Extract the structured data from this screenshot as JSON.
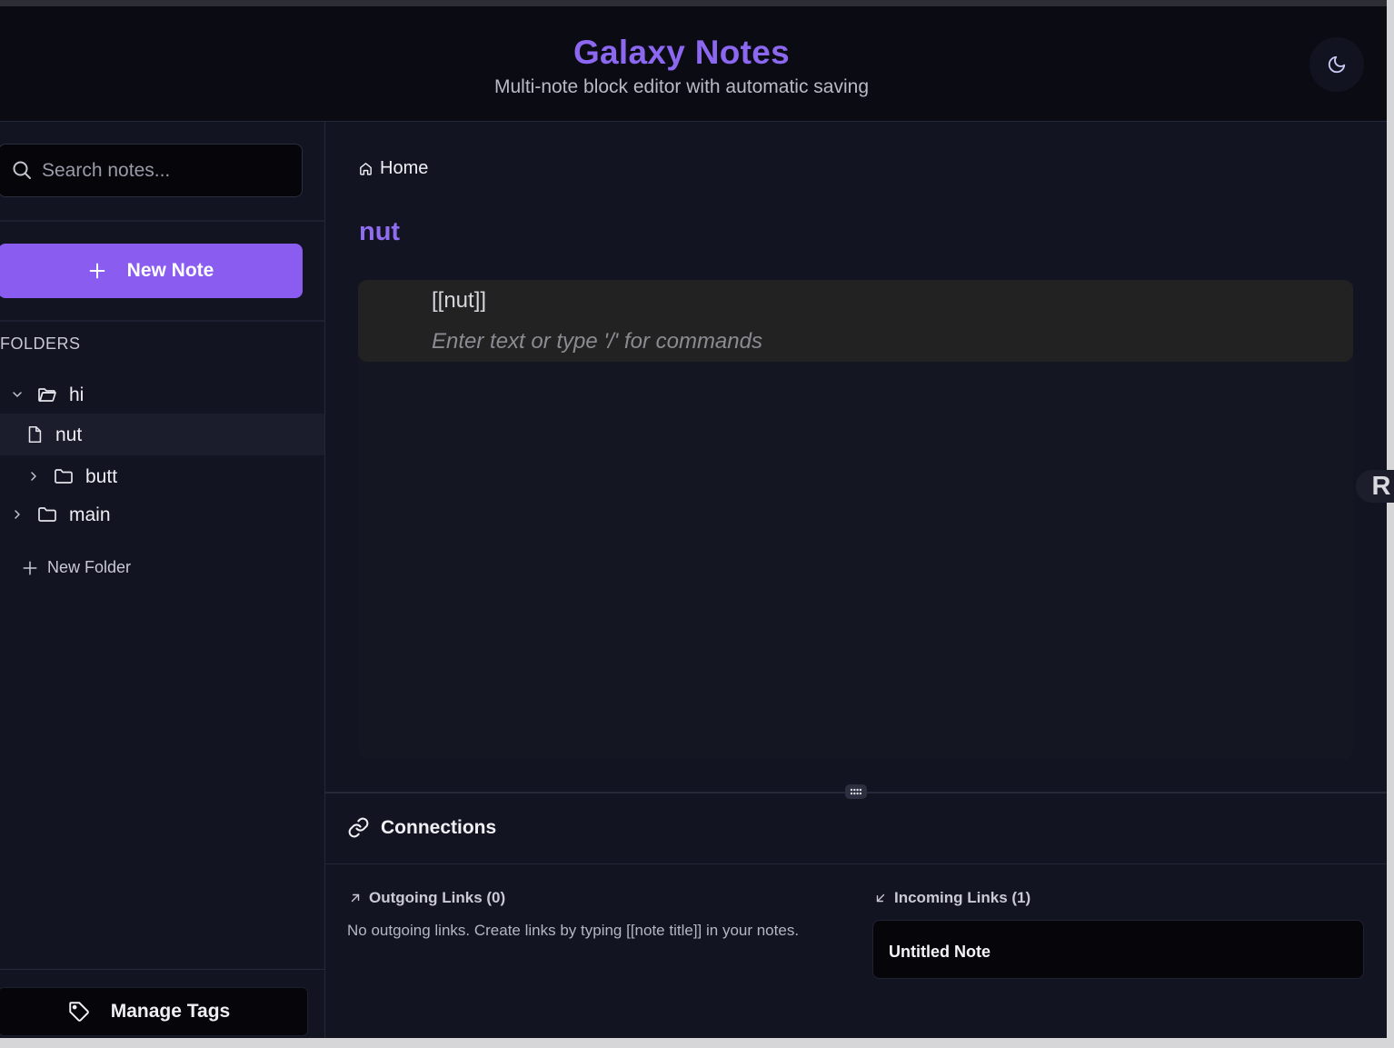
{
  "header": {
    "title": "Galaxy Notes",
    "subtitle": "Multi-note block editor with automatic saving",
    "theme_icon": "moon-icon"
  },
  "sidebar": {
    "search": {
      "placeholder": "Search notes...",
      "value": ""
    },
    "new_note_label": "New Note",
    "folders_label": "FOLDERS",
    "tree": [
      {
        "type": "folder",
        "label": "hi",
        "expanded": true,
        "depth": 0
      },
      {
        "type": "note",
        "label": "nut",
        "selected": true,
        "depth": 1
      },
      {
        "type": "folder",
        "label": "butt",
        "expanded": false,
        "depth": 1
      },
      {
        "type": "folder",
        "label": "main",
        "expanded": false,
        "depth": 0
      }
    ],
    "new_folder_label": "New Folder",
    "manage_tags_label": "Manage Tags"
  },
  "main": {
    "breadcrumb": "Home",
    "note_title": "nut",
    "editor": {
      "block_text": "[[nut]]",
      "placeholder": "Enter text or type '/' for commands"
    },
    "connections": {
      "title": "Connections",
      "outgoing": {
        "label": "Outgoing Links (0)",
        "empty_text": "No outgoing links. Create links by typing [[note title]] in your notes."
      },
      "incoming": {
        "label": "Incoming Links (1)",
        "items": [
          "Untitled Note"
        ]
      }
    }
  },
  "overlay": {
    "side_bubble_letter": "R"
  },
  "colors": {
    "accent": "#8a5cf0",
    "background": "#121422",
    "header": "#0b0b14"
  }
}
